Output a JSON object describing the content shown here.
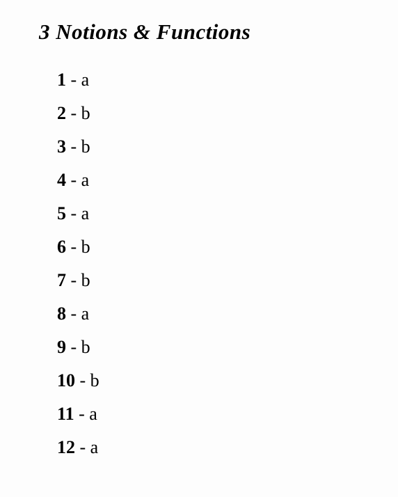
{
  "title": "3 Notions & Functions",
  "answers": [
    {
      "num": "1",
      "val": "a"
    },
    {
      "num": "2",
      "val": "b"
    },
    {
      "num": "3",
      "val": "b"
    },
    {
      "num": "4",
      "val": "a"
    },
    {
      "num": "5",
      "val": "a"
    },
    {
      "num": "6",
      "val": "b"
    },
    {
      "num": "7",
      "val": "b"
    },
    {
      "num": "8",
      "val": "a"
    },
    {
      "num": "9",
      "val": "b"
    },
    {
      "num": "10",
      "val": "b"
    },
    {
      "num": "11",
      "val": "a"
    },
    {
      "num": "12",
      "val": "a"
    }
  ],
  "separator": " - "
}
